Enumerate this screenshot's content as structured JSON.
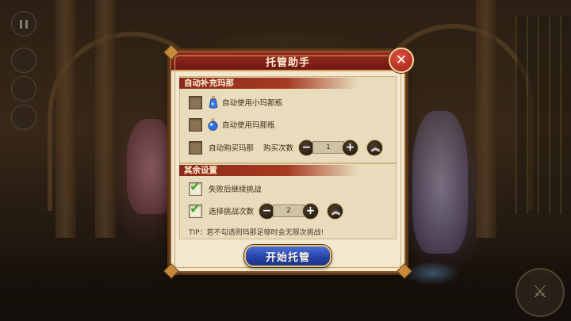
{
  "dialog": {
    "title": "托管助手",
    "close_icon": "close-icon"
  },
  "auto_mana": {
    "header": "自动补充玛那",
    "items": [
      {
        "label": "自动使用小玛那瓶",
        "checked": false,
        "icon": "small-mana-potion-icon"
      },
      {
        "label": "自动使用玛那瓶",
        "checked": false,
        "icon": "mana-potion-icon"
      }
    ],
    "buy": {
      "label": "自动购买玛那",
      "count_label": "购买次数",
      "checked": false,
      "count": "1"
    }
  },
  "other_settings": {
    "header": "其余设置",
    "continue_on_fail": {
      "label": "失败后继续挑战",
      "checked": true
    },
    "challenge_count": {
      "label": "选择挑战次数",
      "checked": true,
      "count": "2"
    }
  },
  "tip": "TIP：若不勾选则玛那足够时会无限次挑战!",
  "start_button": "开始托管",
  "stepper_symbols": {
    "minus": "−",
    "plus": "+",
    "max": "︽"
  },
  "colors": {
    "title_bar": "#8c2a1a",
    "panel_bg": "#f2e8cf",
    "start_button": "#2643a8",
    "check_green": "#3fa52c"
  }
}
